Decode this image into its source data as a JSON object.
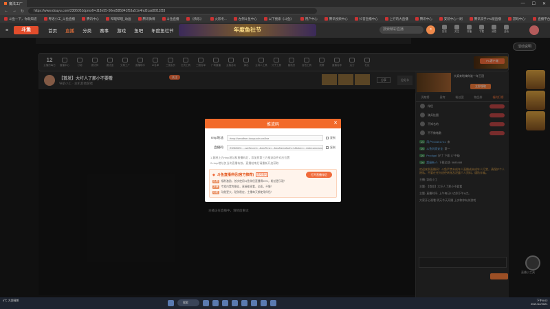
{
  "browser": {
    "tab_title": "魔法工厂",
    "url": "https://www.douyu.com/2306051dpmx6=d18n55-50ed585941f53a51n4nd2cad0011f33",
    "bookmarks": [
      "斗鱼一下，你就知道",
      "粤语小工_斗鱼直播",
      "腾讯中心",
      "哔哩哔哩_动画",
      "腾讯微博",
      "斗鱼直播",
      "《快乐》",
      "火影冬...",
      "左侧斗鱼中心",
      "以下搜索《斗鱼》",
      "用户中心",
      "腾讯视频中心",
      "抖音直播中心",
      "上行的大直播",
      "腾讯中心",
      "安装中心一刷",
      "腾讯双手 PC版直播",
      "游戏中心-",
      "直播平台",
      "超能高人 Web 1400"
    ]
  },
  "nav": {
    "logo": "斗鱼",
    "menu": [
      "首页",
      "直播",
      "分类",
      "赛事",
      "游戏",
      "鱼吧",
      "年度鱼社节"
    ],
    "banner": "年度鱼社节",
    "search_placeholder": "搜索精彩直播",
    "rights": [
      "历史",
      "关注",
      "开播",
      "下载",
      "消息",
      "活动"
    ]
  },
  "category_bar": {
    "date_num": "12",
    "date_label": "主播的每日",
    "items": [
      "直播中心",
      "订阅",
      "魔法师",
      "魔法盒",
      "交易工厂",
      "直播助手",
      "AI名单",
      "三国会员",
      "交流工具",
      "三国名单",
      "广场直播",
      "主播活动",
      "演出",
      "主持人工具",
      "分子工具",
      "星航员",
      "自拍工具",
      "亮屏",
      "直播名称",
      "活力",
      "社区"
    ],
    "pc_label": "PC客户端"
  },
  "activity_btn": "活动说明",
  "stream": {
    "title": "【首发】大圩人了那小不要看",
    "follow": "关注",
    "meta": "导航小工 · 主机其他游戏",
    "share_label": "分享",
    "gift_label": "分分卡"
  },
  "side_ad": {
    "text": "大奖来啦嗨你谁一年王冠",
    "button": "立即领取"
  },
  "chat": {
    "tabs": [
      "贡献榜",
      "贵宾",
      "粉丝团",
      "物品排",
      "福利打榜"
    ],
    "rank": [
      "伴侣",
      "骑兵挂圈",
      "不知名的",
      "不不做笔歌"
    ],
    "messages": [
      {
        "user": "用户923451741",
        "text": "来"
      },
      {
        "user": "斗鱼玩家安全",
        "text": "第一"
      },
      {
        "user": "Prodigal",
        "text": "好了 下面 17 中级"
      },
      {
        "user": "超级新人",
        "text": "下载全部: 5685488"
      }
    ],
    "notice": "欢迎来到直播间！斗鱼严禁未成年人直播或未成年人打赏，请保护个人隐私，不要在任何途径转账及泄露个人资料，谨防诈骗。",
    "system_lines": [
      "主播: 导航小工",
      "主题: 【首发】大圩人了那小不要看",
      "主题: 直播时间: 上午每日12点到下午8点。",
      "大家开心观看 明天今天开播 上次和你有关游戏"
    ]
  },
  "modal": {
    "title": "推流码",
    "rtmp_label": "rtmp地址:",
    "rtmp_value": "rtmp://sendfsm.douyucdn.cn/live",
    "code_label": "直播码:",
    "code_value": "23062601...-wsSecret=..&wsTime=..&wsNeedAuth=1&token=..&streamname",
    "copy_label": "复制",
    "tip1": "1.复制上方rtmp地址和直播码后，添加到第三方推流软件对应位置",
    "tip2": "2.rtmp地址仅当次直播有效，直播结束后请重新开启获取",
    "promo_title": "斗鱼直播伴侣(官方推荐)",
    "promo_tag": "限时福利",
    "promo_btn": "打开直播伴侣",
    "promo_lines": [
      {
        "tag": "礼物",
        "text": "福利激励，首次使用斗鱼伴侣直播得20%，粉丝更乐观！"
      },
      {
        "tag": "方便",
        "text": "专程内置库最佳，直接能观看，全面，不慢！"
      },
      {
        "tag": "功能",
        "text": "功能更大，贴别稳定，主播每天都使用伴侣！"
      }
    ]
  },
  "footer_line": "主播正在直播中，请稍后重试",
  "float_label": "直播小工具",
  "taskbar": {
    "weather": "8℃ 大部晴朗",
    "search": "搜索",
    "time": "下午8:02",
    "date": "2021/12/2021"
  }
}
